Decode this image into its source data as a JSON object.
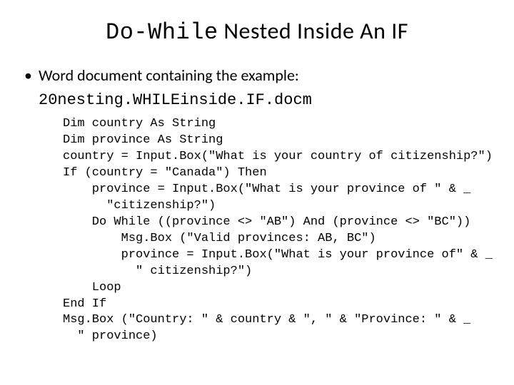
{
  "title_part1": "Do-While",
  "title_part2": " Nested Inside An IF",
  "bullet_text": "Word document containing the example:",
  "filename": "20nesting.WHILEinside.IF.docm",
  "code": "Dim country As String\nDim province As String\ncountry = Input.Box(\"What is your country of citizenship?\")\nIf (country = \"Canada\") Then\n    province = Input.Box(\"What is your province of \" & _\n      \"citizenship?\")\n    Do While ((province <> \"AB\") And (province <> \"BC\"))\n        Msg.Box (\"Valid provinces: AB, BC\")\n        province = Input.Box(\"What is your province of\" & _\n          \" citizenship?\")\n    Loop\nEnd If\nMsg.Box (\"Country: \" & country & \", \" & \"Province: \" & _\n  \" province)"
}
